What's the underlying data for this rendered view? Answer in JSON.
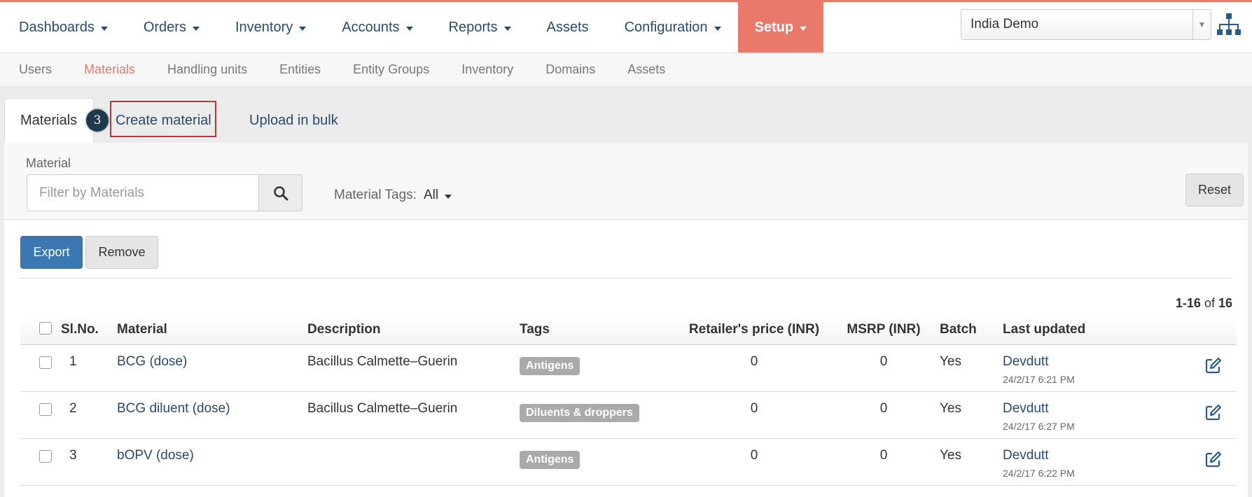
{
  "topnav": {
    "items": [
      {
        "label": "Dashboards",
        "dropdown": true
      },
      {
        "label": "Orders",
        "dropdown": true
      },
      {
        "label": "Inventory",
        "dropdown": true
      },
      {
        "label": "Accounts",
        "dropdown": true
      },
      {
        "label": "Reports",
        "dropdown": true
      },
      {
        "label": "Assets",
        "dropdown": false
      },
      {
        "label": "Configuration",
        "dropdown": true
      },
      {
        "label": "Setup",
        "dropdown": true,
        "active": true
      }
    ],
    "domain_select": "India Demo",
    "accent_color": "#e8796b"
  },
  "subnav": {
    "items": [
      "Users",
      "Materials",
      "Handling units",
      "Entities",
      "Entity Groups",
      "Inventory",
      "Domains",
      "Assets"
    ],
    "active": "Materials"
  },
  "tabs": {
    "materials": "Materials",
    "create": "Create material",
    "upload": "Upload in bulk",
    "step_badge": "3"
  },
  "filter": {
    "label": "Material",
    "placeholder": "Filter by Materials",
    "tags_label": "Material Tags:",
    "tags_value": "All",
    "reset": "Reset"
  },
  "actions": {
    "export": "Export",
    "remove": "Remove"
  },
  "pagination": {
    "range": "1-16",
    "of": "of",
    "total": "16"
  },
  "table": {
    "headers": {
      "slno": "Sl.No.",
      "material": "Material",
      "description": "Description",
      "tags": "Tags",
      "retail": "Retailer's price (INR)",
      "msrp": "MSRP (INR)",
      "batch": "Batch",
      "updated": "Last updated"
    },
    "rows": [
      {
        "slno": "1",
        "material": "BCG (dose)",
        "description": "Bacillus Calmette–Guerin",
        "tag": "Antigens",
        "retail": "0",
        "msrp": "0",
        "batch": "Yes",
        "user": "Devdutt",
        "time": "24/2/17 6:21 PM"
      },
      {
        "slno": "2",
        "material": "BCG diluent (dose)",
        "description": "Bacillus Calmette–Guerin",
        "tag": "Diluents & droppers",
        "retail": "0",
        "msrp": "0",
        "batch": "Yes",
        "user": "Devdutt",
        "time": "24/2/17 6:27 PM"
      },
      {
        "slno": "3",
        "material": "bOPV (dose)",
        "description": "",
        "tag": "Antigens",
        "retail": "0",
        "msrp": "0",
        "batch": "Yes",
        "user": "Devdutt",
        "time": "24/2/17 6:22 PM"
      }
    ]
  }
}
